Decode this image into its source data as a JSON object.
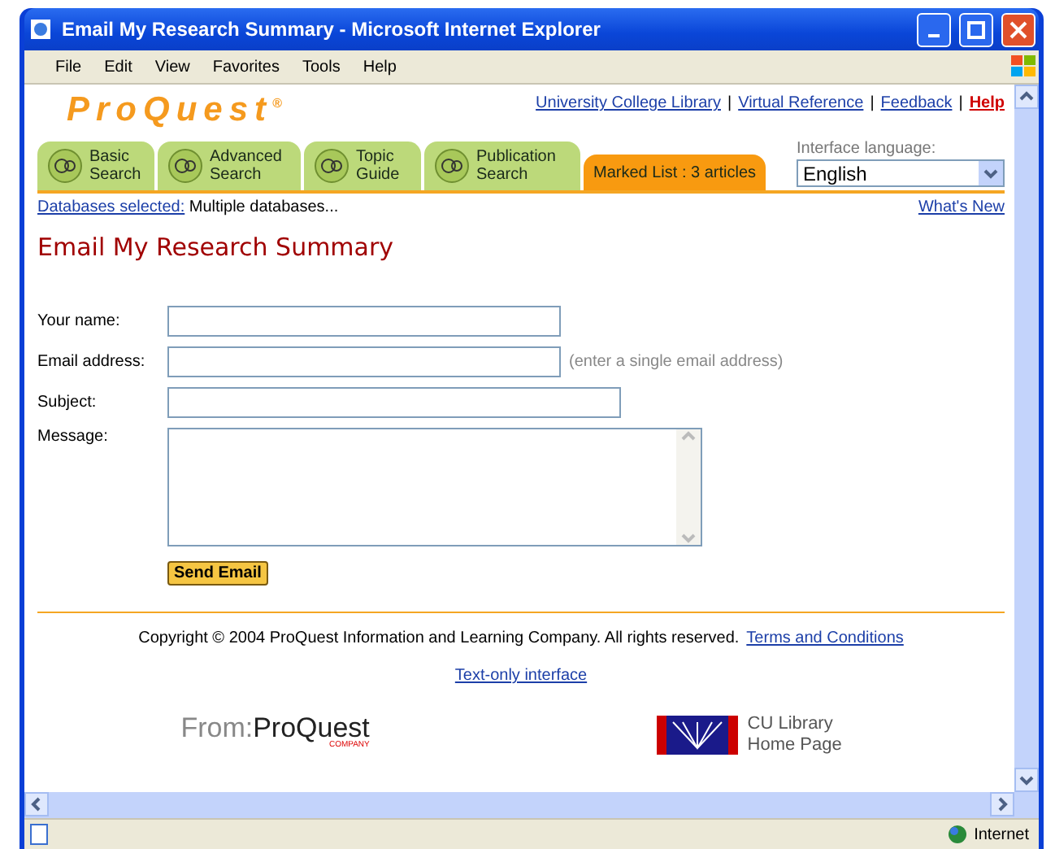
{
  "window": {
    "title": "Email My Research Summary - Microsoft Internet Explorer"
  },
  "menu": [
    "File",
    "Edit",
    "View",
    "Favorites",
    "Tools",
    "Help"
  ],
  "header": {
    "logo": "ProQuest",
    "logo_mark": "®",
    "separator": "|",
    "links": [
      {
        "label": "University College Library",
        "kind": "link"
      },
      {
        "label": "Virtual Reference",
        "kind": "link"
      },
      {
        "label": "Feedback",
        "kind": "link"
      },
      {
        "label": "Help",
        "kind": "help"
      }
    ]
  },
  "tabs": [
    {
      "label": "Basic Search",
      "kind": "search"
    },
    {
      "label": "Advanced Search",
      "kind": "search"
    },
    {
      "label": "Topic Guide",
      "kind": "search"
    },
    {
      "label": "Publication Search",
      "kind": "search"
    },
    {
      "label": "Marked List",
      "count": ": 3 articles",
      "kind": "marked"
    }
  ],
  "language": {
    "label": "Interface language:",
    "value": "English"
  },
  "databases": {
    "link": "Databases selected:",
    "value": "Multiple databases...",
    "whats_new": "What's New"
  },
  "heading": "Email My Research Summary",
  "form": {
    "fields": [
      {
        "label": "Your name:",
        "kind": "short"
      },
      {
        "label": "Email address:",
        "kind": "short",
        "hint": "(enter a single email address)"
      },
      {
        "label": "Subject:",
        "kind": "long"
      },
      {
        "label": "Message:",
        "kind": "area"
      }
    ],
    "button": "Send Email"
  },
  "footer": {
    "copyright": "Copyright © 2004 ProQuest Information and Learning Company. All rights reserved.",
    "terms": "Terms and Conditions",
    "text_only": "Text-only interface",
    "from_logo": {
      "from": "From:",
      "brand": "ProQuest",
      "sub": "COMPANY"
    },
    "library_logo": "CU Library Home Page"
  },
  "status_bar": {
    "zone": "Internet"
  }
}
